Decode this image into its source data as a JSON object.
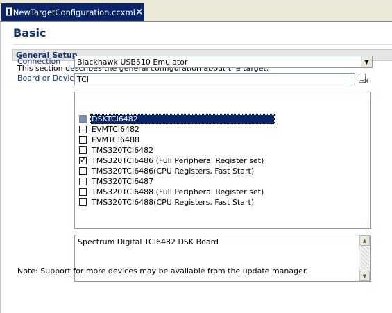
{
  "tab": {
    "title": "*NewTargetConfiguration.ccxml",
    "close_glyph": "✕"
  },
  "page": {
    "title": "Basic"
  },
  "section": {
    "title": "General Setup",
    "description": "This section describes the general configuration about the target."
  },
  "connection": {
    "label": "Connection",
    "value": "Blackhawk USB510 Emulator"
  },
  "board": {
    "label": "Board or Device",
    "filter_value": "TCI"
  },
  "devices": [
    {
      "label": "DSKTCI6482",
      "checked": false,
      "selected": true
    },
    {
      "label": "EVMTCI6482",
      "checked": false,
      "selected": false
    },
    {
      "label": "EVMTCI6488",
      "checked": false,
      "selected": false
    },
    {
      "label": "TMS320TCI6482",
      "checked": false,
      "selected": false
    },
    {
      "label": "TMS320TCI6486 (Full Peripheral Register set)",
      "checked": true,
      "selected": false
    },
    {
      "label": "TMS320TCI6486(CPU Registers, Fast Start)",
      "checked": false,
      "selected": false
    },
    {
      "label": "TMS320TCI6487",
      "checked": false,
      "selected": false
    },
    {
      "label": "TMS320TCI6488 (Full Peripheral Register set)",
      "checked": false,
      "selected": false
    },
    {
      "label": "TMS320TCI6488(CPU Registers, Fast Start)",
      "checked": false,
      "selected": false
    }
  ],
  "device_description": "Spectrum Digital TCI6482 DSK Board",
  "note": "Note: Support for more devices may be available from the update manager.",
  "colors": {
    "accent_blue": "#0c2f73",
    "selection_bg": "#0a246a"
  },
  "icons": {
    "tab": "target-config-icon",
    "clear": "clear-filter-icon",
    "dropdown": "chevron-down-icon"
  }
}
